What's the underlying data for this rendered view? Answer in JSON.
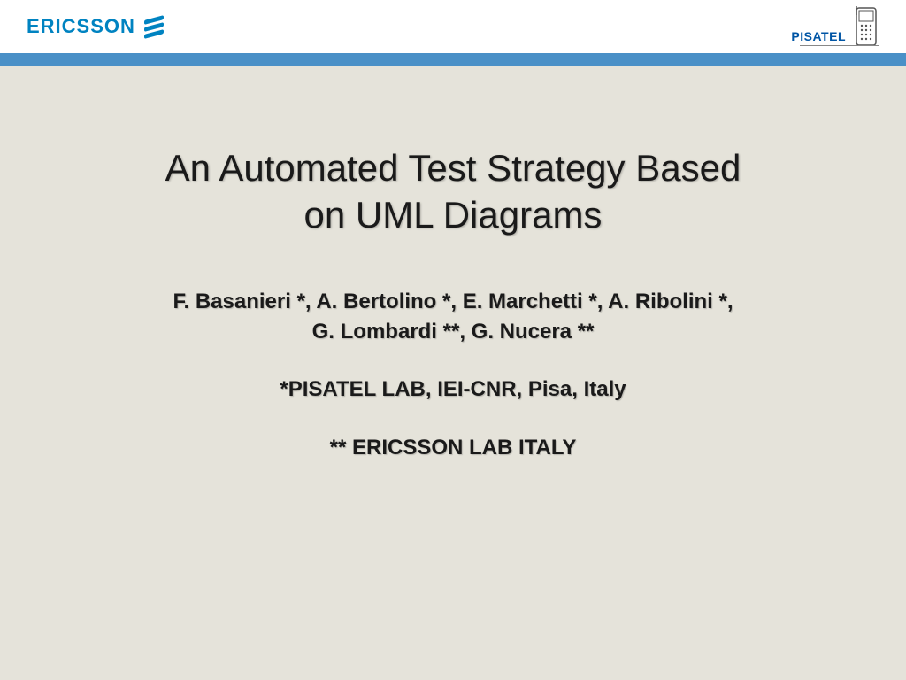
{
  "header": {
    "ericsson_label": "ERICSSON",
    "pisatel_label": "PISATEL"
  },
  "slide": {
    "title_line1": "An Automated Test Strategy Based",
    "title_line2": "on UML Diagrams",
    "authors_line1": "F. Basanieri *, A. Bertolino *, E. Marchetti *, A. Ribolini *,",
    "authors_line2": "G. Lombardi **, G. Nucera **",
    "affiliation1": "*PISATEL LAB, IEI-CNR, Pisa, Italy",
    "affiliation2": "** ERICSSON LAB ITALY"
  }
}
